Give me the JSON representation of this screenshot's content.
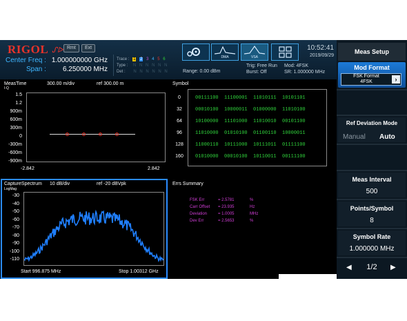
{
  "header": {
    "logo": "RIGOL",
    "logo_mark": "ᔑᐅ",
    "btn_rmt": "Rmt",
    "btn_ext": "Ext",
    "center_freq_label": "Center Freq :",
    "center_freq_value": "1.000000000 GHz",
    "span_label": "Span :",
    "span_value": "6.250000 MHz",
    "trace_label": "Trace :",
    "type_label": "Type :",
    "det_label": "Det :",
    "trace_nums": [
      "1",
      "2",
      "3",
      "4",
      "5",
      "6"
    ],
    "type_vals": [
      "N",
      "N",
      "N",
      "N",
      "N",
      "N"
    ],
    "det_vals": [
      "N",
      "N",
      "N",
      "N",
      "N",
      "N"
    ],
    "range": "Range: 0.00 dBm",
    "trig": "Trig: Free Run",
    "burst": "Burst: Off",
    "mod": "Mod: 4FSK",
    "sr": "SR: 1.000000 MHz",
    "time": "10:52:41",
    "date": "2019/09/29",
    "mode_icons": [
      {
        "icon": "settings-gear-icon",
        "label": ""
      },
      {
        "icon": "spectrum-icon",
        "label": "DMA"
      },
      {
        "icon": "vsa-icon",
        "label": "VSA"
      },
      {
        "icon": "grid-icon",
        "label": ""
      }
    ]
  },
  "meas_time": {
    "title": "MeasTime",
    "iq_label": "I-Q",
    "div": "300.00 m/div",
    "ref": "ref 300.00 m",
    "yticks": [
      "1.5",
      "1.2",
      "900m",
      "600m",
      "300m",
      "0",
      "-300m",
      "-600m",
      "-900m"
    ],
    "xmin": "-2.842",
    "xmax": "2.842"
  },
  "symbol": {
    "title": "Symbol",
    "rows": [
      {
        "index": "0",
        "bits": "00111100  11100001  11010111  10101101"
      },
      {
        "index": "32",
        "bits": "00010100  10000011  01000000  11010100"
      },
      {
        "index": "64",
        "bits": "10100000  11101000  11010010  00101100"
      },
      {
        "index": "96",
        "bits": "11010000  01010100  01100110  10000011"
      },
      {
        "index": "128",
        "bits": "11000110  10111000  10111011  01111100"
      },
      {
        "index": "160",
        "bits": "01010000  00010100  10110011  00111100"
      }
    ]
  },
  "capture": {
    "title": "CaptureSpectrum",
    "div": "10 dB/div",
    "ref": "ref -20 dBVpk",
    "logmag": "LogMag",
    "yticks": [
      "-30",
      "-40",
      "-50",
      "-60",
      "-70",
      "-80",
      "-90",
      "-100",
      "-110"
    ],
    "start": "Start 996.875 MHz",
    "stop": "Stop 1.00312 GHz"
  },
  "errs": {
    "title": "Errs Summary",
    "rows": [
      {
        "label": "FSK Err",
        "value": "= 2.5781",
        "unit": "%"
      },
      {
        "label": "Carr Offset",
        "value": "= 23.935",
        "unit": "Hz"
      },
      {
        "label": "Deviation",
        "value": "= 1.0005",
        "unit": "MHz"
      },
      {
        "label": "Dev Err",
        "value": "= 2.5653",
        "unit": "%"
      }
    ]
  },
  "softkeys": {
    "title": "Meas Setup",
    "mod_format_title": "Mod Format",
    "mod_format_value_1": "FSK Format",
    "mod_format_value_2": "4FSK",
    "ref_dev_title": "Ref Deviation Mode",
    "ref_dev_manual": "Manual",
    "ref_dev_auto": "Auto",
    "meas_interval_title": "Meas Interval",
    "meas_interval_value": "500",
    "points_title": "Points/Symbol",
    "points_value": "8",
    "symbol_rate_title": "Symbol Rate",
    "symbol_rate_value": "1.000000 MHz",
    "page": "1/2"
  },
  "colors": {
    "accent": "#2b8cff",
    "symbol_bits": "#2fd13b",
    "errs_text": "#d23ed8",
    "spectrum": "#1f7fff"
  }
}
